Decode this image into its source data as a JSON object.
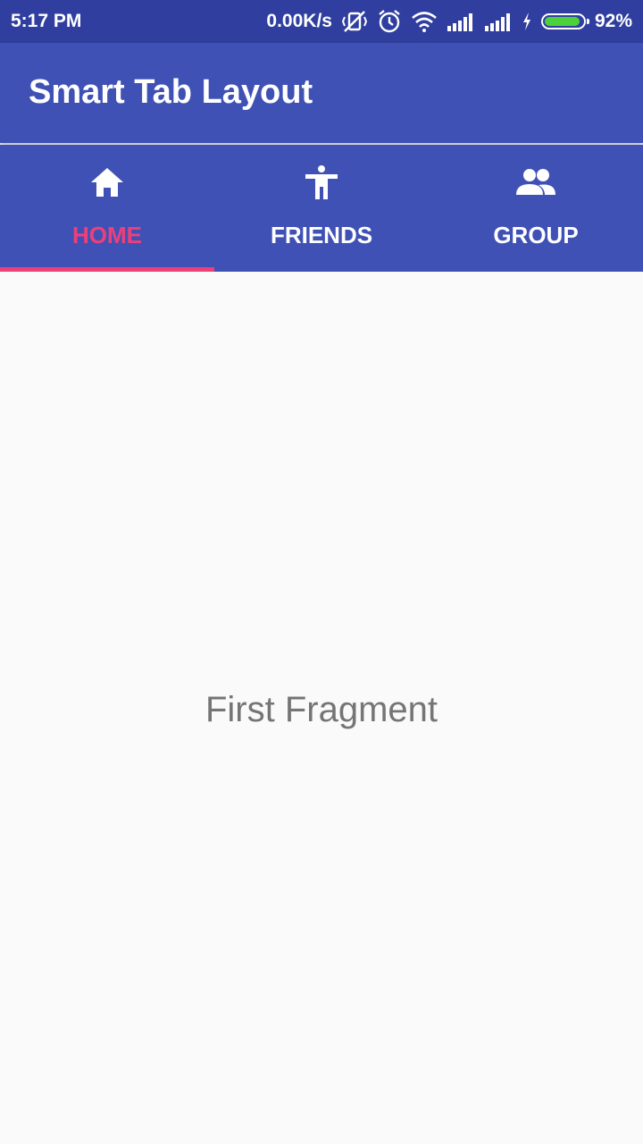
{
  "status_bar": {
    "time": "5:17 PM",
    "network_speed": "0.00K/s",
    "battery_percent": "92%",
    "battery_level": 0.92,
    "icons": [
      "vibrate-off-icon",
      "alarm-icon",
      "wifi-icon",
      "signal-icon",
      "signal-icon",
      "charging-icon",
      "battery-icon"
    ]
  },
  "app_bar": {
    "title": "Smart Tab Layout",
    "color": "#3f51b5"
  },
  "tabs": [
    {
      "label": "HOME",
      "icon": "home-icon",
      "active": true
    },
    {
      "label": "FRIENDS",
      "icon": "person-icon",
      "active": false
    },
    {
      "label": "GROUP",
      "icon": "group-icon",
      "active": false
    }
  ],
  "colors": {
    "primary": "#3f51b5",
    "primary_dark": "#303f9f",
    "accent": "#ec407a",
    "battery": "#4cd13a"
  },
  "content": {
    "fragment_text": "First Fragment"
  }
}
